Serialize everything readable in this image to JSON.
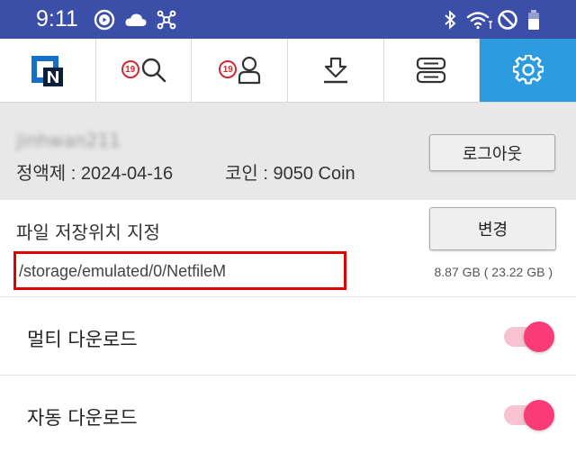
{
  "status_bar": {
    "time": "9:11",
    "left_icons": [
      "media-playing-icon",
      "cloud-icon",
      "network-hub-icon"
    ],
    "right_icons": [
      "bluetooth-icon",
      "wifi-icon",
      "do-not-disturb-icon",
      "battery-icon"
    ],
    "bg_color": "#3b4fa8"
  },
  "tabs": [
    {
      "name": "home",
      "icon": "netfile-logo-icon",
      "badge": null,
      "active": false
    },
    {
      "name": "search",
      "icon": "search-icon",
      "badge": "19",
      "active": false
    },
    {
      "name": "account",
      "icon": "person-icon",
      "badge": "19",
      "active": false
    },
    {
      "name": "download",
      "icon": "download-icon",
      "badge": null,
      "active": false
    },
    {
      "name": "storage",
      "icon": "server-icon",
      "badge": null,
      "active": false
    },
    {
      "name": "settings",
      "icon": "gear-icon",
      "badge": null,
      "active": true
    }
  ],
  "account": {
    "username": "jinhwan211",
    "plan_text": "정액제 : 2024-04-16",
    "coin_text": "코인 : 9050 Coin",
    "logout_label": "로그아웃"
  },
  "storage": {
    "title": "파일 저장위치 지정",
    "change_label": "변경",
    "path": "/storage/emulated/0/NetfileM",
    "size_text": "8.87 GB ( 23.22 GB )"
  },
  "settings": {
    "multi_download_label": "멀티 다운로드",
    "multi_download_on": true,
    "auto_download_label": "자동 다운로드",
    "auto_download_on": true
  },
  "colors": {
    "accent": "#2d9be0",
    "toggle_on": "#fb3a78",
    "toggle_track": "#f7c2d2",
    "highlight_box": "#e00000"
  }
}
